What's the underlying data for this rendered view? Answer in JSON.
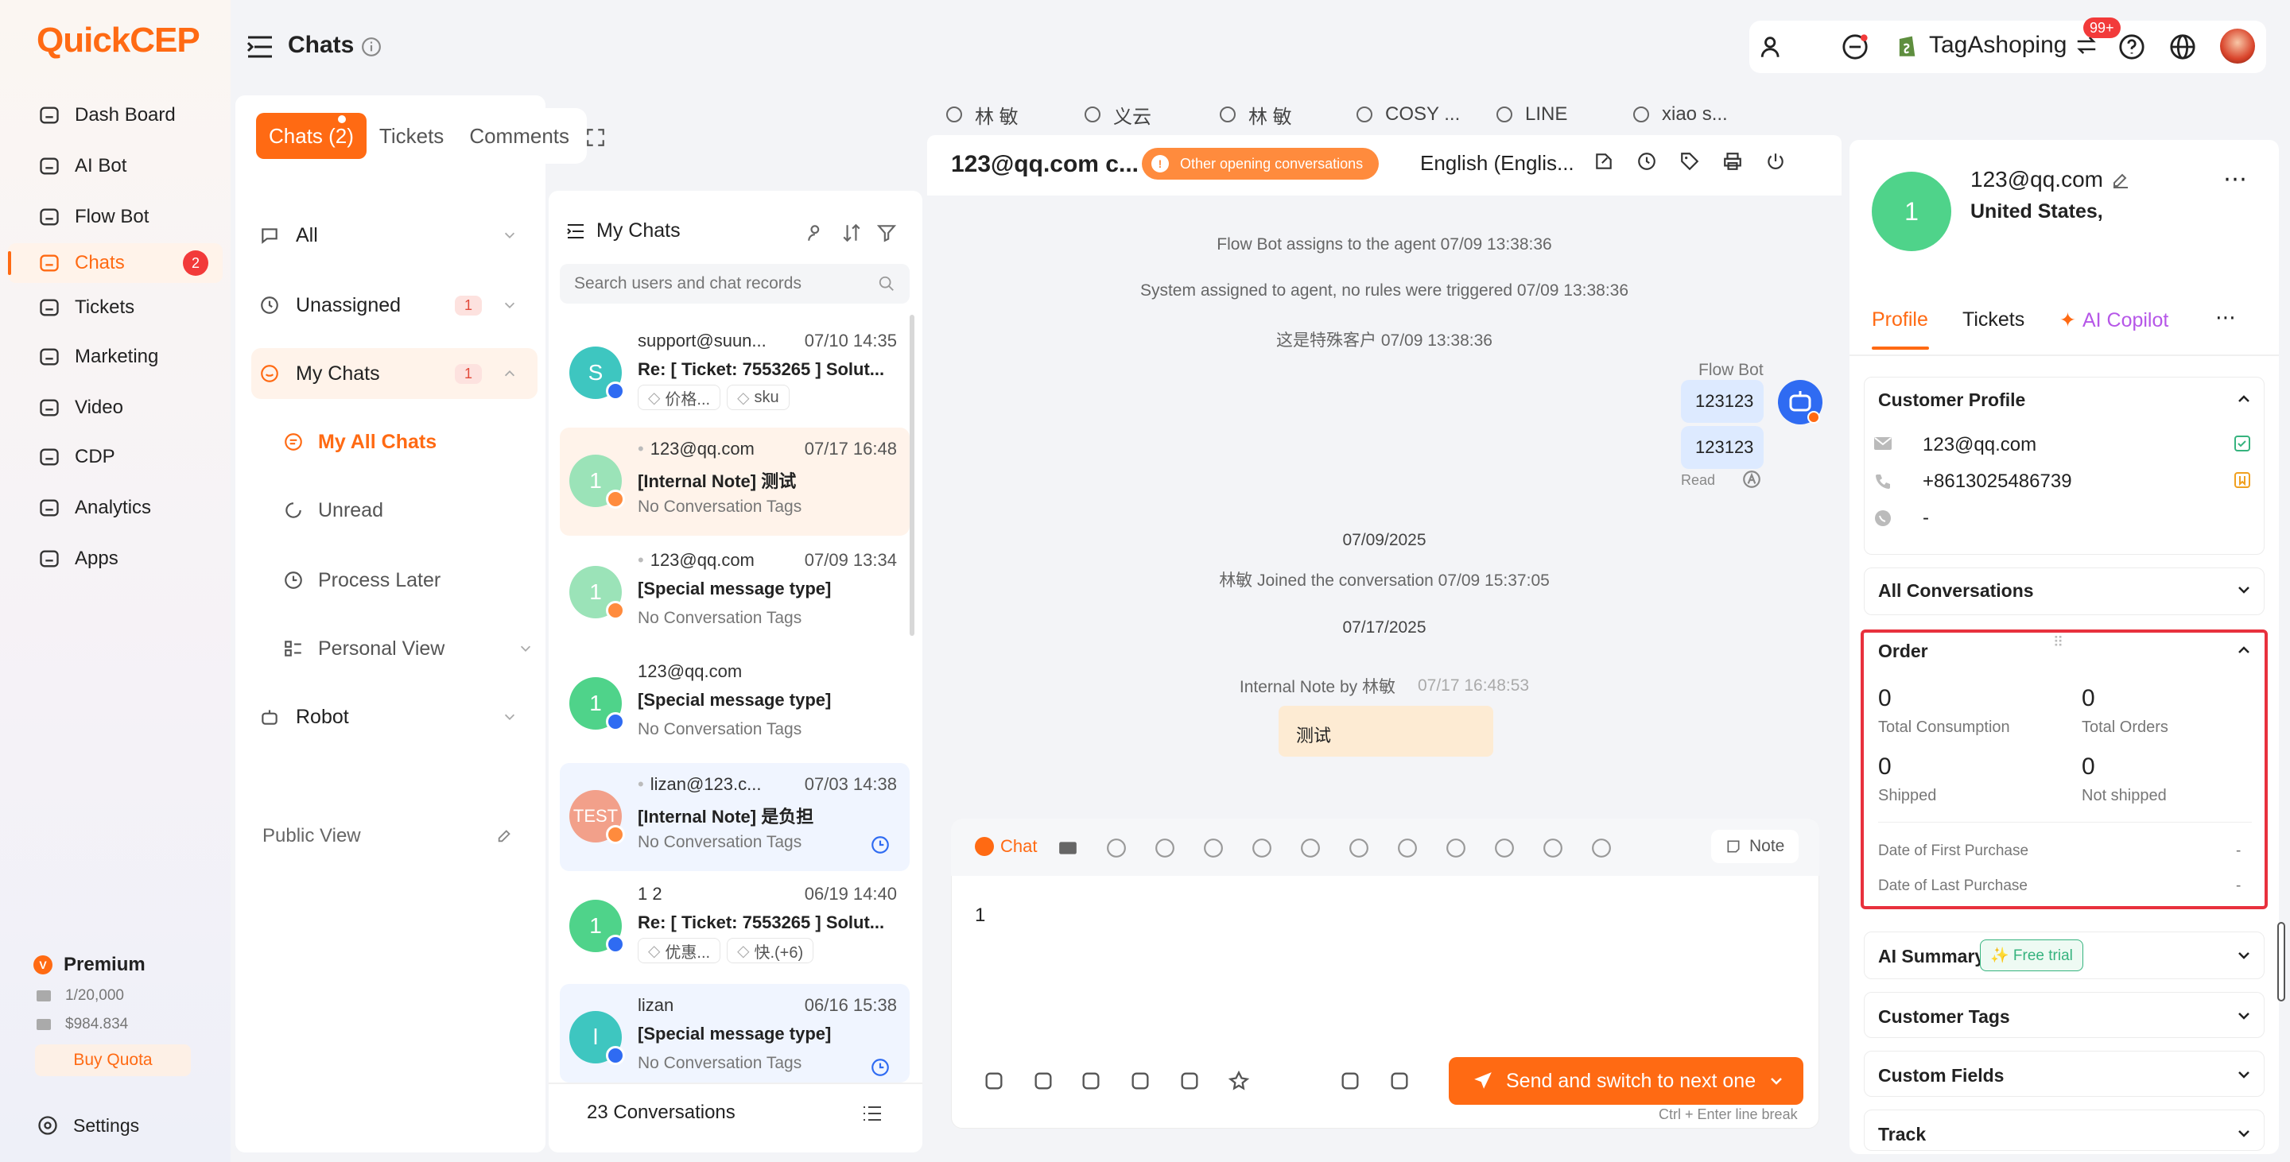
{
  "app": {
    "logo_a": "Q",
    "logo_b": "uickCEP",
    "page_title": "Chats"
  },
  "nav": {
    "items": [
      {
        "label": "Dash Board",
        "icon": "dashboard-icon"
      },
      {
        "label": "AI Bot",
        "icon": "robot-icon"
      },
      {
        "label": "Flow Bot",
        "icon": "flow-icon"
      },
      {
        "label": "Chats",
        "icon": "chat-icon",
        "badge": "2"
      },
      {
        "label": "Tickets",
        "icon": "ticket-icon"
      },
      {
        "label": "Marketing",
        "icon": "marketing-icon"
      },
      {
        "label": "Video",
        "icon": "video-icon"
      },
      {
        "label": "CDP",
        "icon": "cdp-icon"
      },
      {
        "label": "Analytics",
        "icon": "bulb-icon"
      },
      {
        "label": "Apps",
        "icon": "apps-icon"
      }
    ],
    "plan": {
      "name": "Premium",
      "quota": "1/20,000",
      "balance": "$984.834",
      "buy": "Buy Quota"
    },
    "settings": "Settings"
  },
  "header": {
    "store": "TagAshoping",
    "notif_badge": "99+"
  },
  "folders": {
    "tabs": [
      "Chats (2)",
      "Tickets",
      "Comments"
    ],
    "all": "All",
    "unassigned": "Unassigned",
    "unassigned_count": "1",
    "mychats": "My Chats",
    "mychats_count": "1",
    "my_all_chats": "My All Chats",
    "unread": "Unread",
    "process_later": "Process Later",
    "personal_view": "Personal View",
    "robot": "Robot",
    "public_view": "Public View"
  },
  "chatlist": {
    "title": "My Chats",
    "search_placeholder": "Search users and chat records",
    "footer": "23 Conversations",
    "rows": [
      {
        "avatar": "S",
        "color": "#3ec6c0",
        "name": "support@suun...",
        "time": "07/10 14:35",
        "line2": "Re: [ Ticket: 7553265 ] Solut...",
        "tags": [
          "价格...",
          "sku"
        ]
      },
      {
        "avatar": "1",
        "color": "#9be3b8",
        "name": "123@qq.com",
        "time": "07/17 16:48",
        "line2": "[Internal Note] 测试",
        "line3": "No Conversation Tags"
      },
      {
        "avatar": "1",
        "color": "#9be3b8",
        "name": "123@qq.com",
        "time": "07/09 13:34",
        "line2": "[Special message type]",
        "line3": "No Conversation Tags"
      },
      {
        "avatar": "1",
        "color": "#4fd38a",
        "name": "123@qq.com",
        "time": "",
        "line2": "[Special message type]",
        "line3": "No Conversation Tags"
      },
      {
        "avatar": "TEST",
        "color": "#f2a08a",
        "name": "lizan@123.c...",
        "time": "07/03 14:38",
        "line2": "[Internal Note] 是负担",
        "line3": "No Conversation Tags"
      },
      {
        "avatar": "1",
        "color": "#4fd38a",
        "name": "1 2",
        "time": "06/19 14:40",
        "line2": "Re: [ Ticket: 7553265 ] Solut...",
        "tags": [
          "优惠...",
          "快.(+6)"
        ]
      },
      {
        "avatar": "l",
        "color": "#3ec6c0",
        "name": "lizan",
        "time": "06/16 15:38",
        "line2": "[Special message type]",
        "line3": "No Conversation Tags"
      }
    ]
  },
  "conv": {
    "tabs": [
      "林 敏",
      "义云",
      "林 敏",
      "COSY ...",
      "LINE",
      "xiao s..."
    ],
    "contact": "123@qq.com c...",
    "other_open": "Other opening conversations",
    "language": "English (Englis...",
    "sys1": "Flow Bot assigns to the agent  07/09 13:38:36",
    "sys2": "System assigned to agent, no rules were triggered  07/09 13:38:36",
    "sys3": "这是特殊客户  07/09 13:38:36",
    "bot_name": "Flow Bot",
    "bubble1": "123123",
    "bubble2": "123123",
    "read": "Read",
    "date1": "07/09/2025",
    "joined": "林敏 Joined the conversation   07/09 15:37:05",
    "date2": "07/17/2025",
    "note_by": "Internal Note by 林敏",
    "note_time": "07/17 16:48:53",
    "note_text": "测试",
    "composer_tab": "Chat",
    "note_btn": "Note",
    "input_value": "1",
    "send": "Send and switch to next one",
    "hint": "Ctrl + Enter line break"
  },
  "profile": {
    "avatar": "1",
    "email": "123@qq.com",
    "location": "United States,",
    "tabs": [
      "Profile",
      "Tickets",
      "AI Copilot"
    ],
    "customer_profile": "Customer Profile",
    "cp_email": "123@qq.com",
    "cp_phone": "+8613025486739",
    "cp_whatsapp": "-",
    "all_conversations": "All Conversations",
    "order": "Order",
    "total_consumption_v": "0",
    "total_consumption": "Total Consumption",
    "total_orders_v": "0",
    "total_orders": "Total Orders",
    "shipped_v": "0",
    "shipped": "Shipped",
    "not_shipped_v": "0",
    "not_shipped": "Not shipped",
    "first_purchase": "Date of First Purchase",
    "first_purchase_v": "-",
    "last_purchase": "Date of Last Purchase",
    "last_purchase_v": "-",
    "ai_summary": "AI Summary",
    "free_trial": "✨ Free trial",
    "customer_tags": "Customer Tags",
    "custom_fields": "Custom Fields",
    "track": "Track"
  },
  "colors": {
    "accent": "#ff6a13",
    "blue": "#2f6bf2",
    "highlight": "#e8313d"
  }
}
